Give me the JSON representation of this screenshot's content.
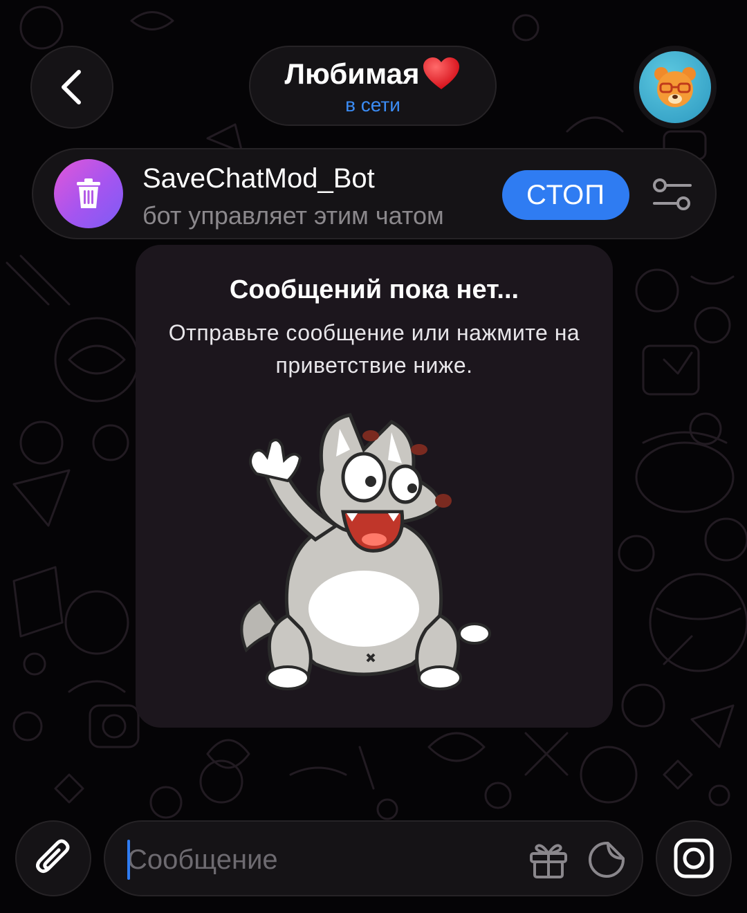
{
  "header": {
    "title": "Любимая",
    "status": "в сети",
    "title_emoji_icon": "heart-icon",
    "back_icon": "chevron-left-icon",
    "avatar_icon": "bear-avatar-icon"
  },
  "bot_bar": {
    "name": "SaveChatMod_Bot",
    "description": "бот управляет этим чатом",
    "stop_label": "СТОП",
    "bot_icon": "trash-icon",
    "settings_icon": "sliders-icon"
  },
  "empty_state": {
    "title": "Сообщений пока нет...",
    "text": "Отправьте сообщение или нажмите на приветствие ниже.",
    "sticker": "waving-wolf-sticker"
  },
  "composer": {
    "placeholder": "Сообщение",
    "value": "",
    "attach_icon": "paperclip-icon",
    "gift_icon": "gift-icon",
    "sticker_icon": "sticker-icon",
    "camera_icon": "camera-icon"
  },
  "colors": {
    "accent": "#2f7cf2",
    "status": "#3b8cf5",
    "background": "#050406",
    "card": "#1c161d"
  }
}
